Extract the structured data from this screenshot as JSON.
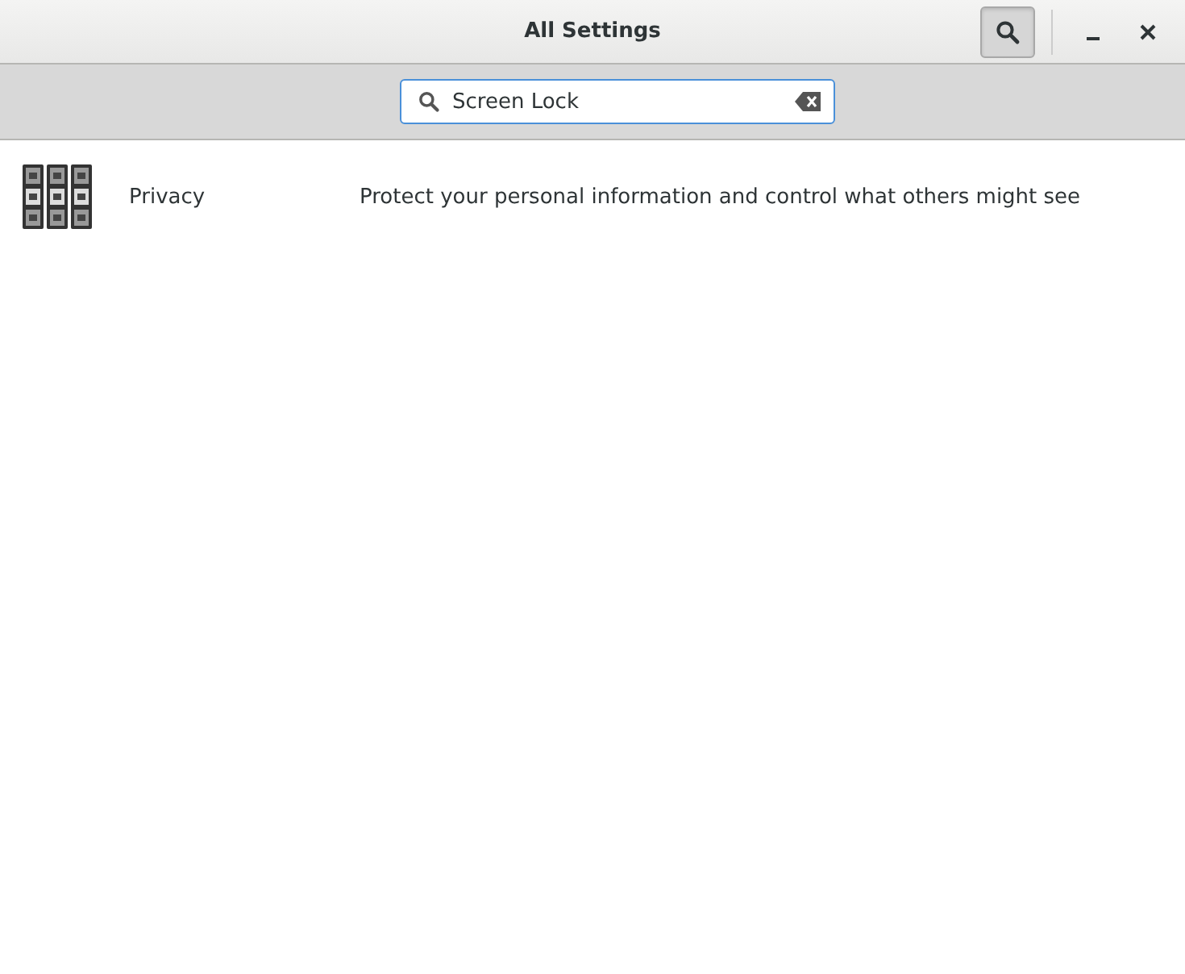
{
  "window": {
    "title": "All Settings",
    "search_toggle_on": true
  },
  "search": {
    "value": "Screen Lock"
  },
  "results": [
    {
      "name": "Privacy",
      "description": "Protect your personal information and control what others might see"
    }
  ]
}
